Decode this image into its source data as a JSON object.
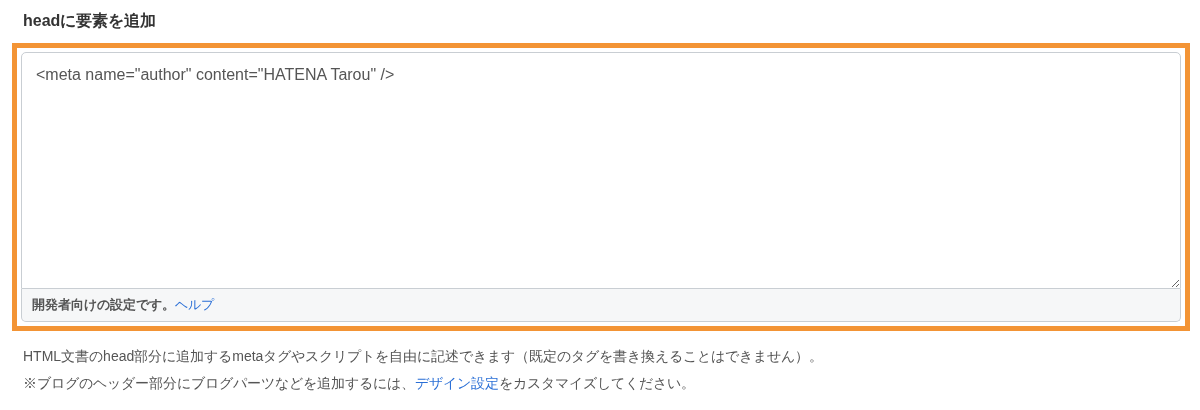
{
  "heading": "headに要素を追加",
  "editor": {
    "value": "<meta name=\"author\" content=\"HATENA Tarou\" />",
    "highlighted": true,
    "footer_text": "開発者向けの設定です。",
    "footer_link": "ヘルプ"
  },
  "description": "HTML文書のhead部分に追加するmetaタグやスクリプトを自由に記述できます（既定のタグを書き換えることはできません）。",
  "note": {
    "before": "※ブログのヘッダー部分にブログパーツなどを追加するには、",
    "link": "デザイン設定",
    "after": "をカスタマイズしてください。"
  }
}
